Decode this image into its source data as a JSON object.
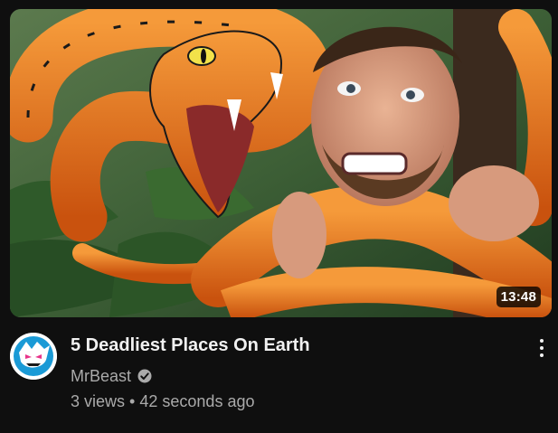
{
  "video": {
    "title": "5 Deadliest Places On Earth",
    "channel": "MrBeast",
    "views": "3 views",
    "separator": "•",
    "age": "42 seconds ago",
    "duration": "13:48",
    "verified": true
  },
  "icons": {
    "verified": "verified-check-icon",
    "more": "more-vertical-icon",
    "avatar": "channel-avatar"
  },
  "colors": {
    "background": "#0f0f0f",
    "title": "#f1f1f1",
    "secondary_text": "#aaaaaa",
    "snake_orange": "#e8731a"
  }
}
